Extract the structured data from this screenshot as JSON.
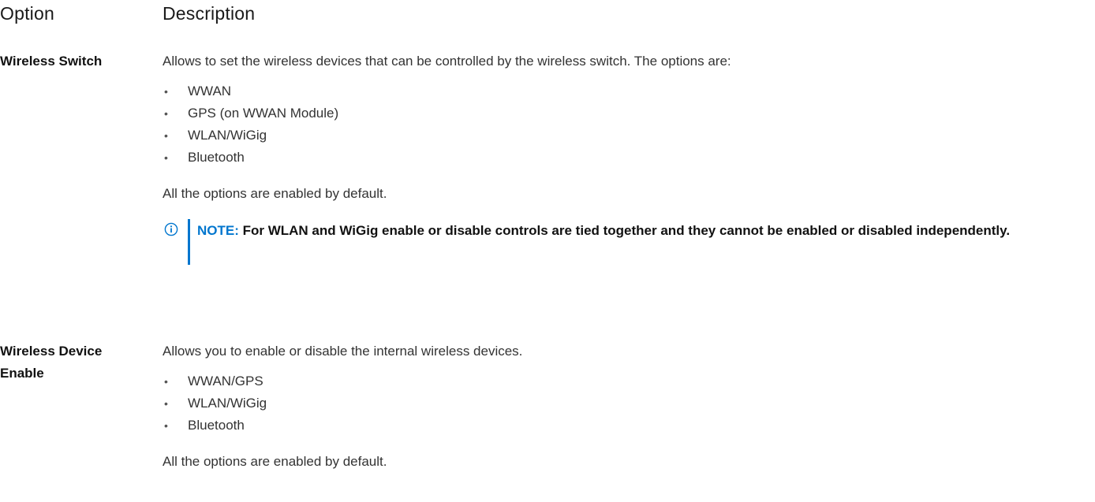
{
  "table": {
    "headers": {
      "option": "Option",
      "description": "Description"
    },
    "rows": [
      {
        "option": "Wireless Switch",
        "intro": "Allows to set the wireless devices that can be controlled by the wireless switch. The options are:",
        "items": [
          "WWAN",
          "GPS (on WWAN Module)",
          "WLAN/WiGig",
          "Bluetooth"
        ],
        "footer": "All the options are enabled by default.",
        "note": {
          "label": "NOTE:",
          "text": " For WLAN and WiGig enable or disable controls are tied together and they cannot be enabled or disabled independently.",
          "icon": "info-icon"
        }
      },
      {
        "option_line1": "Wireless Device",
        "option_line2": "Enable",
        "intro": "Allows you to enable or disable the internal wireless devices.",
        "items": [
          "WWAN/GPS",
          "WLAN/WiGig",
          "Bluetooth"
        ],
        "footer": "All the options are enabled by default."
      }
    ]
  },
  "bullet_glyph": "•",
  "colors": {
    "note_accent": "#0076ce",
    "text": "#333333"
  }
}
